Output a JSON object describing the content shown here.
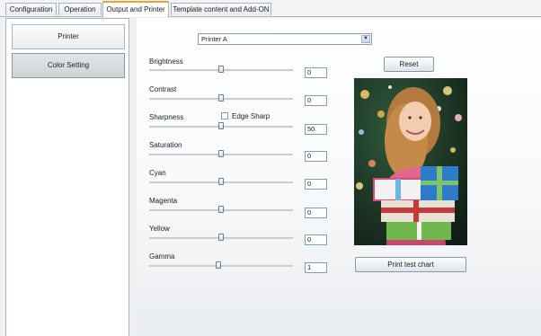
{
  "tabs": [
    {
      "label": "Configuration",
      "active": false
    },
    {
      "label": "Operation",
      "active": false
    },
    {
      "label": "Output and Printer",
      "active": true
    },
    {
      "label": "Template content and Add-ON",
      "active": false
    }
  ],
  "sidebar": {
    "printer_label": "Printer",
    "color_setting_label": "Color Setting"
  },
  "printer_select": {
    "value": "Printer A"
  },
  "sliders": [
    {
      "label": "Brightness",
      "value": "0",
      "fraction": 0.5
    },
    {
      "label": "Contrast",
      "value": "0",
      "fraction": 0.5
    },
    {
      "label": "Sharpness",
      "value": "50",
      "fraction": 0.5
    },
    {
      "label": "Saturation",
      "value": "0",
      "fraction": 0.5
    },
    {
      "label": "Cyan",
      "value": "0",
      "fraction": 0.5
    },
    {
      "label": "Magenta",
      "value": "0",
      "fraction": 0.5
    },
    {
      "label": "Yellow",
      "value": "0",
      "fraction": 0.5
    },
    {
      "label": "Gamma",
      "value": "1",
      "fraction": 0.48
    }
  ],
  "edge_sharp": {
    "label": "Edge Sharp",
    "checked": false
  },
  "buttons": {
    "reset_label": "Reset",
    "print_test_label": "Print test chart"
  },
  "colors": {
    "active_tab_accent": "#e8a33a"
  }
}
